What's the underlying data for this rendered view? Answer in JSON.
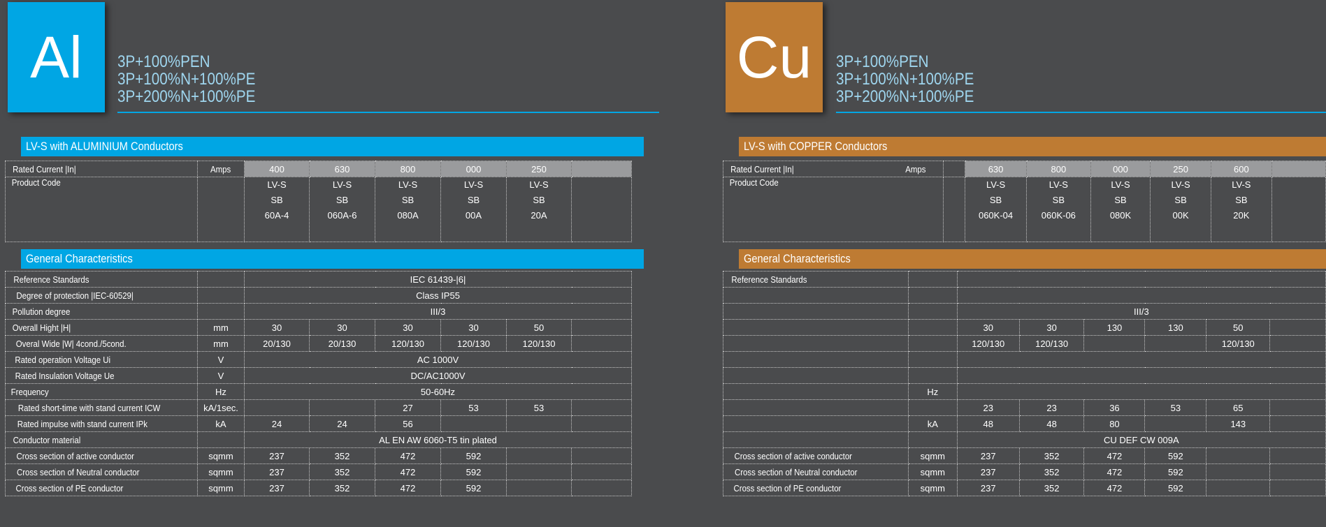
{
  "panels": [
    {
      "symbol": "Al",
      "configs": [
        "3P+100%PEN",
        "3P+100%N+100%PE",
        "3P+200%N+100%PE"
      ],
      "section_title": "LV-S with ALUMINIUM Conductors",
      "product_table": {
        "current_label": "Rated Current |In|",
        "current_unit": "Amps",
        "ratings": [
          "400",
          "630",
          "800",
          "000",
          "250",
          ""
        ],
        "code_label": "Product Code",
        "codes": [
          [
            "LV-S",
            "SB",
            "60A-4"
          ],
          [
            "LV-S",
            "SB",
            "060A-6"
          ],
          [
            "LV-S",
            "SB",
            "080A"
          ],
          [
            "LV-S",
            "SB",
            "00A"
          ],
          [
            "LV-S",
            "SB",
            "20A"
          ],
          [
            "",
            "",
            ""
          ]
        ]
      },
      "general_title": "General Characteristics",
      "general_rows": [
        {
          "label": "Reference Standards",
          "unit": "",
          "span": "IEC 61439-|6|"
        },
        {
          "label": "Degree of protection |IEC-60529|",
          "unit": "",
          "span": "Class IP55"
        },
        {
          "label": "Pollution degree",
          "unit": "",
          "span": "III/3"
        },
        {
          "label": "Overall Hight |H|",
          "unit": "mm",
          "values": [
            "30",
            "30",
            "30",
            "30",
            "50",
            ""
          ]
        },
        {
          "label": "Overal Wide |W|   4cond./5cond.",
          "unit": "mm",
          "values": [
            "20/130",
            "20/130",
            "120/130",
            "120/130",
            "120/130",
            ""
          ]
        },
        {
          "label": "Rated operation Voltage Ui",
          "unit": "V",
          "span": "AC 1000V"
        },
        {
          "label": "Rated Insulation Voltage Ue",
          "unit": "V",
          "span": "DC/AC1000V"
        },
        {
          "label": "Frequency",
          "unit": "Hz",
          "span": "50-60Hz"
        },
        {
          "label": "Rated short-time with stand current ICW",
          "unit": "kA/1sec.",
          "values": [
            "",
            "",
            "27",
            "53",
            "53",
            ""
          ]
        },
        {
          "label": "Rated impulse with stand current IPk",
          "unit": "kA",
          "values": [
            "24",
            "24",
            "56",
            "",
            "",
            ""
          ]
        },
        {
          "label": "Conductor material",
          "unit": "",
          "span": "AL EN AW 6060-T5 tin plated"
        },
        {
          "label": "Cross section of active conductor",
          "unit": "sqmm",
          "values": [
            "237",
            "352",
            "472",
            "592",
            "",
            ""
          ]
        },
        {
          "label": "Cross section of Neutral conductor",
          "unit": "sqmm",
          "values": [
            "237",
            "352",
            "472",
            "592",
            "",
            ""
          ]
        },
        {
          "label": "Cross section of PE conductor",
          "unit": "sqmm",
          "values": [
            "237",
            "352",
            "472",
            "592",
            "",
            ""
          ]
        }
      ]
    },
    {
      "symbol": "Cu",
      "configs": [
        "3P+100%PEN",
        "3P+100%N+100%PE",
        "3P+200%N+100%PE"
      ],
      "section_title": "LV-S with COPPER Conductors",
      "product_table": {
        "current_label": "Rated Current |In|",
        "current_unit": "Amps",
        "ratings": [
          "630",
          "800",
          "000",
          "250",
          "600",
          ""
        ],
        "code_label": "Product Code",
        "codes": [
          [
            "LV-S",
            "SB",
            "060K-04"
          ],
          [
            "LV-S",
            "SB",
            "060K-06"
          ],
          [
            "LV-S",
            "SB",
            "080K"
          ],
          [
            "LV-S",
            "SB",
            "00K"
          ],
          [
            "LV-S",
            "SB",
            "20K"
          ],
          [
            "",
            "",
            ""
          ]
        ]
      },
      "general_title": "General Characteristics",
      "general_rows": [
        {
          "label": "Reference Standards",
          "unit": "",
          "span": ""
        },
        {
          "label": "",
          "unit": "",
          "span": ""
        },
        {
          "label": "",
          "unit": "",
          "span": "III/3"
        },
        {
          "label": "",
          "unit": "",
          "values": [
            "30",
            "30",
            "130",
            "130",
            "50",
            ""
          ]
        },
        {
          "label": "",
          "unit": "",
          "values": [
            "120/130",
            "120/130",
            "",
            "",
            "120/130",
            ""
          ]
        },
        {
          "label": "",
          "unit": "",
          "span": ""
        },
        {
          "label": "",
          "unit": "",
          "span": ""
        },
        {
          "label": "",
          "unit": "Hz",
          "span": ""
        },
        {
          "label": "",
          "unit": "",
          "values": [
            "23",
            "23",
            "36",
            "53",
            "65",
            ""
          ]
        },
        {
          "label": "",
          "unit": "kA",
          "values": [
            "48",
            "48",
            "80",
            "",
            "143",
            ""
          ]
        },
        {
          "label": "",
          "unit": "",
          "span": "CU DEF CW 009A"
        },
        {
          "label": "Cross section of active conductor",
          "unit": "sqmm",
          "values": [
            "237",
            "352",
            "472",
            "592",
            "",
            ""
          ]
        },
        {
          "label": "Cross section of Neutral conductor",
          "unit": "sqmm",
          "values": [
            "237",
            "352",
            "472",
            "592",
            "",
            ""
          ]
        },
        {
          "label": "Cross section of PE conductor",
          "unit": "sqmm",
          "values": [
            "237",
            "352",
            "472",
            "592",
            "",
            ""
          ]
        }
      ]
    }
  ]
}
